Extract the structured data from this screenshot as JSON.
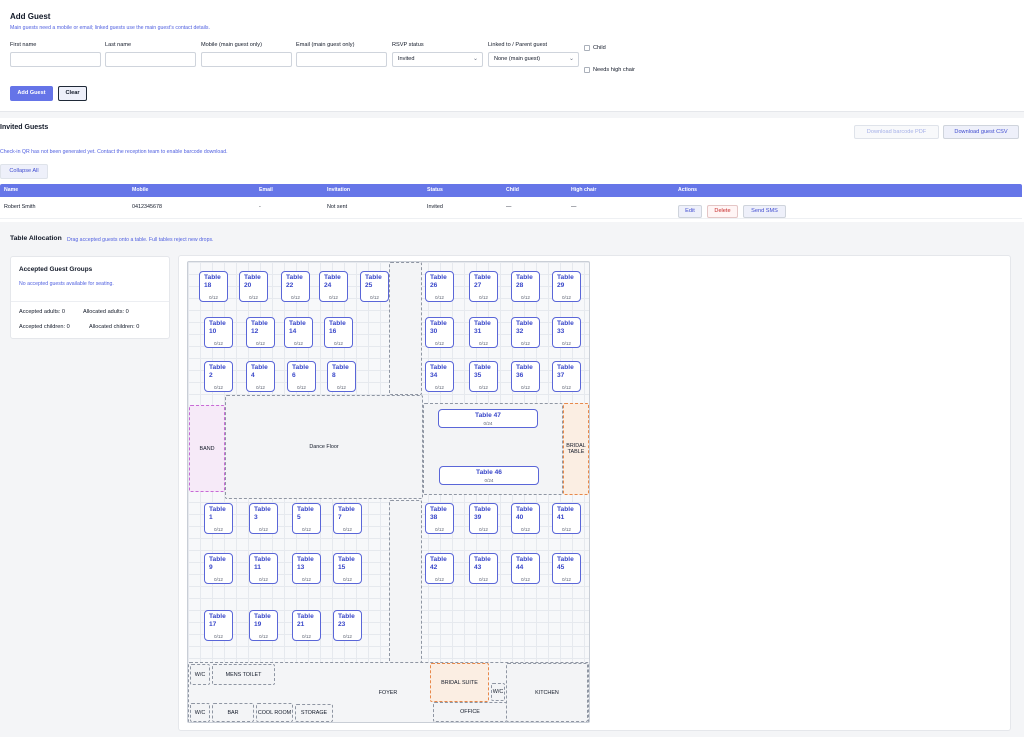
{
  "add_guest": {
    "title": "Add Guest",
    "hint": "Main guests need a mobile or email; linked guests use the main guest's contact details.",
    "fields": {
      "first_name": "First name",
      "last_name": "Last name",
      "mobile": "Mobile (main guest only)",
      "email": "Email (main guest only)",
      "rsvp": "RSVP status",
      "linked": "Linked to / Parent guest"
    },
    "rsvp_value": "Invited",
    "linked_value": "None (main guest)",
    "child_label": "Child",
    "highchair_label": "Needs high chair",
    "add_button": "Add Guest",
    "clear_button": "Clear"
  },
  "invited": {
    "title": "Invited Guests",
    "qr_note": "Check-in QR has not been generated yet. Contact the reception team to enable barcode download.",
    "download_pdf": "Download barcode PDF",
    "download_csv": "Download guest CSV",
    "collapse_all": "Collapse All",
    "columns": {
      "name": "Name",
      "mobile": "Mobile",
      "email": "Email",
      "invitation": "Invitation",
      "status": "Status",
      "child": "Child",
      "high_chair": "High chair",
      "actions": "Actions"
    },
    "row": {
      "name": "Robert Smith",
      "mobile": "0412345678",
      "email": "-",
      "invitation": "Not sent",
      "status": "Invited",
      "child": "—",
      "high_chair": "—"
    },
    "edit": "Edit",
    "delete": "Delete",
    "send_sms": "Send SMS"
  },
  "allocation": {
    "title": "Table Allocation",
    "hint": "Drag accepted guests onto a table. Full tables reject new drops.",
    "groups_title": "Accepted Guest Groups",
    "groups_note": "No accepted guests available for seating.",
    "accepted_adults": "Accepted adults: 0",
    "allocated_adults": "Allocated adults: 0",
    "accepted_children": "Accepted children: 0",
    "allocated_children": "Allocated children: 0"
  },
  "floor": {
    "dance_floor": "Dance Floor",
    "band": "BAND",
    "bridal_table": "BRIDAL TABLE",
    "mens_toilet": "MENS TOILET",
    "wc": "W/C",
    "bar": "BAR",
    "cool_room": "COOL ROOM",
    "storage": "STORAGE",
    "foyer": "FOYER",
    "bridal_suite": "BRIDAL SUITE",
    "office": "OFFICE",
    "kitchen": "KITCHEN",
    "band_color": "#c86ad6",
    "bridal_color": "#e7884a",
    "table_color": "#5a66d8",
    "tables": [
      {
        "label": "Table 18",
        "count": "0/12"
      },
      {
        "label": "Table 20",
        "count": "0/12"
      },
      {
        "label": "Table 22",
        "count": "0/12"
      },
      {
        "label": "Table 24",
        "count": "0/12"
      },
      {
        "label": "Table 25",
        "count": "0/12"
      },
      {
        "label": "Table 26",
        "count": "0/12"
      },
      {
        "label": "Table 27",
        "count": "0/12"
      },
      {
        "label": "Table 28",
        "count": "0/12"
      },
      {
        "label": "Table 29",
        "count": "0/12"
      },
      {
        "label": "Table 10",
        "count": "0/12"
      },
      {
        "label": "Table 12",
        "count": "0/12"
      },
      {
        "label": "Table 14",
        "count": "0/12"
      },
      {
        "label": "Table 16",
        "count": "0/12"
      },
      {
        "label": "Table 30",
        "count": "0/12"
      },
      {
        "label": "Table 31",
        "count": "0/12"
      },
      {
        "label": "Table 32",
        "count": "0/12"
      },
      {
        "label": "Table 33",
        "count": "0/12"
      },
      {
        "label": "Table 2",
        "count": "0/12"
      },
      {
        "label": "Table 4",
        "count": "0/12"
      },
      {
        "label": "Table 6",
        "count": "0/12"
      },
      {
        "label": "Table 8",
        "count": "0/12"
      },
      {
        "label": "Table 34",
        "count": "0/12"
      },
      {
        "label": "Table 35",
        "count": "0/12"
      },
      {
        "label": "Table 36",
        "count": "0/12"
      },
      {
        "label": "Table 37",
        "count": "0/12"
      },
      {
        "label": "Table 1",
        "count": "0/12"
      },
      {
        "label": "Table 3",
        "count": "0/12"
      },
      {
        "label": "Table 5",
        "count": "0/12"
      },
      {
        "label": "Table 7",
        "count": "0/12"
      },
      {
        "label": "Table 38",
        "count": "0/12"
      },
      {
        "label": "Table 39",
        "count": "0/12"
      },
      {
        "label": "Table 40",
        "count": "0/12"
      },
      {
        "label": "Table 41",
        "count": "0/12"
      },
      {
        "label": "Table 9",
        "count": "0/12"
      },
      {
        "label": "Table 11",
        "count": "0/12"
      },
      {
        "label": "Table 13",
        "count": "0/12"
      },
      {
        "label": "Table 15",
        "count": "0/12"
      },
      {
        "label": "Table 42",
        "count": "0/12"
      },
      {
        "label": "Table 43",
        "count": "0/12"
      },
      {
        "label": "Table 44",
        "count": "0/12"
      },
      {
        "label": "Table 45",
        "count": "0/12"
      },
      {
        "label": "Table 17",
        "count": "0/12"
      },
      {
        "label": "Table 19",
        "count": "0/12"
      },
      {
        "label": "Table 21",
        "count": "0/12"
      },
      {
        "label": "Table 23",
        "count": "0/12"
      }
    ],
    "wide_tables": [
      {
        "label": "Table 47",
        "count": "0/24"
      },
      {
        "label": "Table 46",
        "count": "0/24"
      }
    ]
  }
}
